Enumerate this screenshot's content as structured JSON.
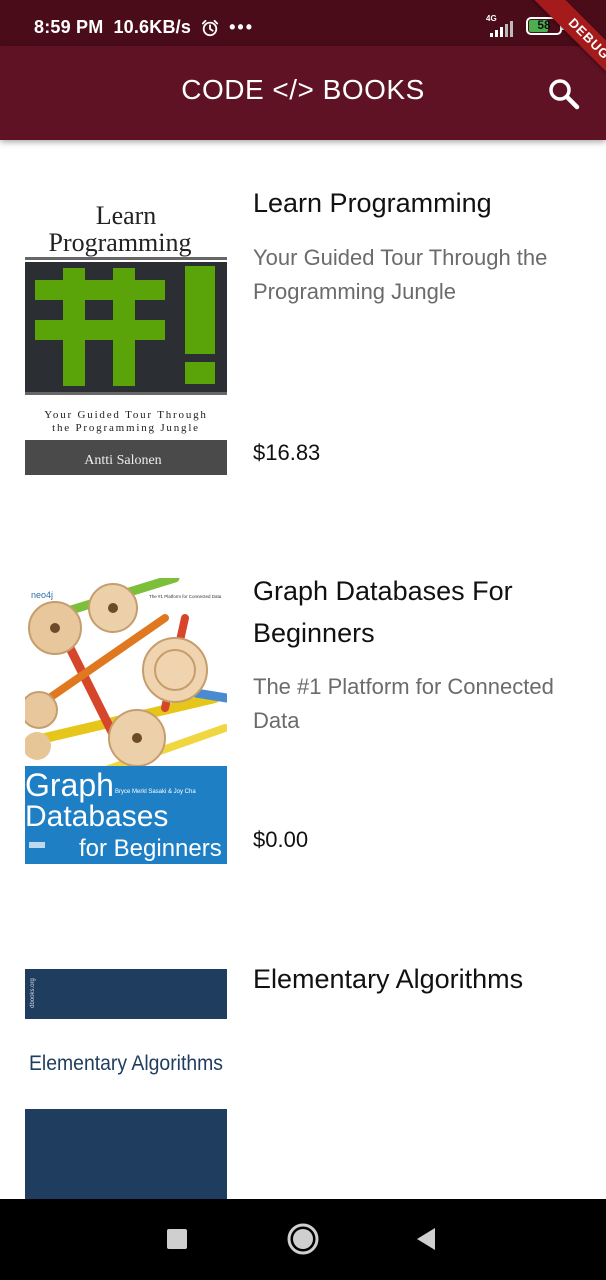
{
  "status_bar": {
    "time": "8:59 PM",
    "speed": "10.6KB/s",
    "more": "•••",
    "network_label": "4G",
    "battery_percent": "58",
    "battery_level": 0.58,
    "icons": [
      "alarm-icon",
      "signal-icon",
      "battery-icon"
    ]
  },
  "app_bar": {
    "title": "CODE </> BOOKS",
    "search_icon": "search-icon",
    "debug_banner": "DEBUG",
    "color": "#5e1224"
  },
  "books": [
    {
      "title": "Learn Programming",
      "subtitle": "Your Guided Tour Through the Programming Jungle",
      "price": "$16.83",
      "cover": {
        "title_line1": "Learn",
        "title_line2": "Programming",
        "tagline_line1": "Your Guided Tour Through",
        "tagline_line2": "the Programming Jungle",
        "author": "Antti Salonen",
        "symbol": "#!"
      }
    },
    {
      "title": "Graph Databases For Beginners",
      "subtitle": "The #1 Platform for Connected Data",
      "price": "$0.00",
      "cover": {
        "brand": "neo4j",
        "tag": "The #1 Platform for Connected Data",
        "authors": "Bryce Merkl Sasaki & Joy Cha",
        "line1": "Graph",
        "line2": "Databases",
        "line3": "for Beginners"
      }
    },
    {
      "title": "Elementary Algorithms",
      "subtitle": "",
      "price": "",
      "cover": {
        "spine": "dbooks.org",
        "title": "Elementary Algorithms"
      }
    }
  ],
  "nav_bar": {
    "icons": [
      "recents-square-icon",
      "home-circle-icon",
      "back-triangle-icon"
    ]
  }
}
